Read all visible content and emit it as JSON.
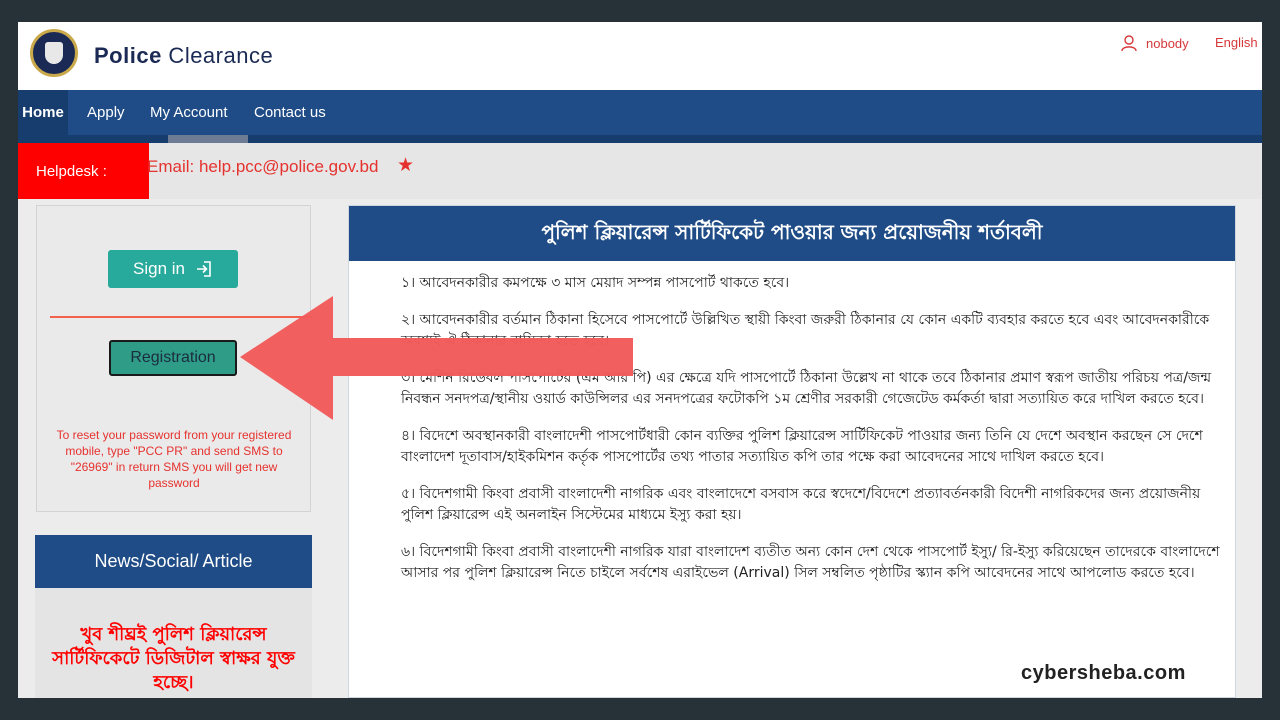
{
  "header": {
    "brand_strong": "Police",
    "brand_rest": " Clearance",
    "user_name": "nobody",
    "language": "English"
  },
  "nav": {
    "items": [
      {
        "label": "Home"
      },
      {
        "label": "Apply"
      },
      {
        "label": "My Account"
      },
      {
        "label": "Contact us"
      }
    ]
  },
  "helpdesk": {
    "tag": "Helpdesk :",
    "text": "Email: help.pcc@police.gov.bd",
    "star": "★"
  },
  "login_box": {
    "signin_label": "Sign in",
    "registration_label": "Registration",
    "reset_note": "To reset your password from your registered mobile, type \"PCC PR\" and send SMS to \"26969\" in return SMS you will get new password"
  },
  "news": {
    "title": "News/Social/ Article",
    "text": "খুব শীঘ্রই পুলিশ ক্লিয়ারেন্স সার্টিফিকেটে ডিজিটাল স্বাক্ষর যুক্ত হচ্ছে।"
  },
  "terms": {
    "title": "পুলিশ ক্লিয়ারেন্স সার্টিফিকেট পাওয়ার জন্য প্রয়োজনীয় শর্তাবলী",
    "items": [
      "১। আবেদনকারীর কমপক্ষে ৩ মাস মেয়াদ সম্পন্ন পাসপোর্ট থাকতে হবে।",
      "২। আবেদনকারীর বর্তমান ঠিকানা হিসেবে পাসপোর্টে উল্লিখিত স্থায়ী কিংবা জরুরী ঠিকানার যে কোন একটি ব্যবহার করতে হবে এবং আবেদনকারীকে অবশ্যই ঐ ঠিকানার বাসিন্দা হতে হবে।",
      "৩। মেশিন রিডেবল পাসপোর্টের (এম আর পি) এর ক্ষেত্রে যদি পাসপোর্টে ঠিকানা উল্লেখ না থাকে তবে ঠিকানার প্রমাণ স্বরূপ জাতীয় পরিচয় পত্র/জন্ম নিবন্ধন সনদপত্র/স্থানীয় ওয়ার্ড কাউন্সিলর এর সনদপত্রের ফটোকপি ১ম শ্রেণীর সরকারী গেজেটেড কর্মকর্তা দ্বারা সত্যায়িত করে দাখিল করতে হবে।",
      "৪। বিদেশে অবস্থানকারী বাংলাদেশী পাসপোর্টধারী কোন ব্যক্তির পুলিশ ক্লিয়ারেন্স সার্টিফিকেট পাওয়ার জন্য তিনি যে দেশে অবস্থান করছেন সে দেশে বাংলাদেশ দূতাবাস/হাইকমিশন কর্তৃক পাসপোর্টের তথ্য পাতার সত্যায়িত কপি তার পক্ষে করা আবেদনের সাথে দাখিল করতে হবে।",
      "৫। বিদেশগামী কিংবা প্রবাসী বাংলাদেশী নাগরিক এবং বাংলাদেশে বসবাস করে স্বদেশে/বিদেশে প্রত্যাবর্তনকারী বিদেশী নাগরিকদের জন্য প্রয়োজনীয় পুলিশ ক্লিয়ারেন্স এই অনলাইন সিস্টেমের মাধ্যমে ইস্যু করা হয়।",
      "৬। বিদেশগামী কিংবা প্রবাসী বাংলাদেশী নাগরিক যারা বাংলাদেশ ব্যতীত অন্য কোন দেশ থেকে পাসপোর্ট ইস্যু/ রি-ইস্যু করিয়েছেন তাদেরকে বাংলাদেশে আসার পর পুলিশ ক্লিয়ারেন্স নিতে চাইলে সর্বশেষ এরাইভেল (Arrival) সিল সম্বলিত পৃষ্ঠাটির স্ক্যান কপি আবেদনের সাথে আপলোড করতে হবে।"
    ]
  },
  "watermark": "cybersheba.com",
  "colors": {
    "nav": "#1f4c86",
    "helpdesk_tag": "#ff0000",
    "signin": "#27a99b",
    "arrow": "#f25a5a",
    "alert_text": "#e6322e"
  },
  "icons": {
    "logo": "police-emblem-icon",
    "user": "user-icon",
    "signin": "sign-in-icon",
    "annotation": "left-arrow-icon"
  }
}
